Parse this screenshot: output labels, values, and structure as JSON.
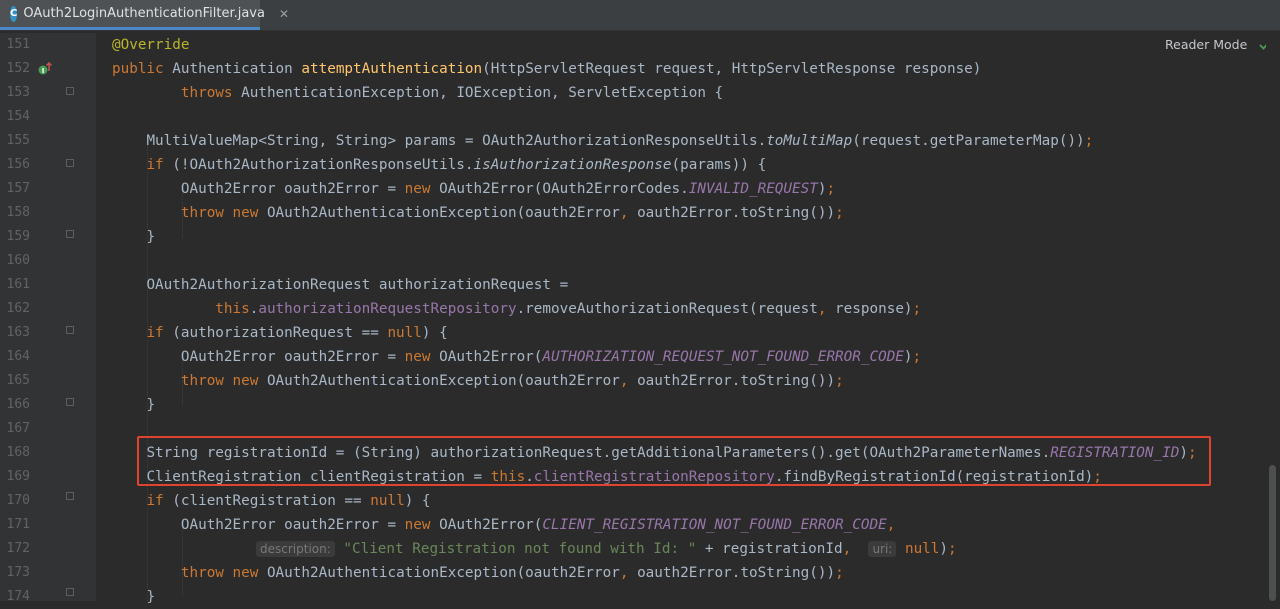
{
  "tab": {
    "title": "OAuth2LoginAuthenticationFilter.java",
    "icon_letter": "C",
    "close_label": "✕"
  },
  "toolbar": {
    "reader_mode": "Reader Mode"
  },
  "line_numbers": [
    "151",
    "152",
    "153",
    "154",
    "155",
    "156",
    "157",
    "158",
    "159",
    "160",
    "161",
    "162",
    "163",
    "164",
    "165",
    "166",
    "167",
    "168",
    "169",
    "170",
    "171",
    "172",
    "173",
    "174"
  ],
  "code": {
    "l151": {
      "ann": "@Override"
    },
    "l152": {
      "kw": "public",
      "t1": " Authentication ",
      "fn": "attemptAuthentication",
      "t2": "(HttpServletRequest request, HttpServletResponse response)"
    },
    "l153": {
      "kw": "throws",
      "t1": " AuthenticationException, IOException, ServletException {"
    },
    "l155": {
      "t1": "MultiValueMap<String, String> params = OAuth2AuthorizationResponseUtils.",
      "sm": "toMultiMap",
      "t2": "(request.getParameterMap())",
      "semi": ";"
    },
    "l156": {
      "kw": "if",
      "t1": " (!OAuth2AuthorizationResponseUtils.",
      "sm": "isAuthorizationResponse",
      "t2": "(params)) {"
    },
    "l157": {
      "t1": "OAuth2Error oauth2Error = ",
      "kw": "new",
      "t2": " OAuth2Error(OAuth2ErrorCodes.",
      "cst": "INVALID_REQUEST",
      "t3": ")",
      "semi": ";"
    },
    "l158": {
      "kw": "throw new",
      "t1": " OAuth2AuthenticationException(oauth2Error",
      "comma": ",",
      "t2": " oauth2Error.toString())",
      "semi": ";"
    },
    "l159": {
      "t1": "}"
    },
    "l161": {
      "t1": "OAuth2AuthorizationRequest authorizationRequest ="
    },
    "l162": {
      "kw": "this",
      "t1": ".",
      "fld": "authorizationRequestRepository",
      "t2": ".removeAuthorizationRequest(request",
      "comma": ",",
      "t3": " response)",
      "semi": ";"
    },
    "l163": {
      "kw": "if",
      "t1": " (authorizationRequest == ",
      "kw2": "null",
      "t2": ") {"
    },
    "l164": {
      "t1": "OAuth2Error oauth2Error = ",
      "kw": "new",
      "t2": " OAuth2Error(",
      "cst": "AUTHORIZATION_REQUEST_NOT_FOUND_ERROR_CODE",
      "t3": ")",
      "semi": ";"
    },
    "l165": {
      "kw": "throw new",
      "t1": " OAuth2AuthenticationException(oauth2Error",
      "comma": ",",
      "t2": " oauth2Error.toString())",
      "semi": ";"
    },
    "l166": {
      "t1": "}"
    },
    "l168": {
      "t1": "String registrationId = (String) authorizationRequest.getAdditionalParameters().get(OAuth2ParameterNames.",
      "cst": "REGISTRATION_ID",
      "t2": ")",
      "semi": ";"
    },
    "l169": {
      "t1": "ClientRegistration clientRegistration = ",
      "kw": "this",
      "t2": ".",
      "fld": "clientRegistrationRepository",
      "t3": ".findByRegistrationId(registrationId)",
      "semi": ";"
    },
    "l170": {
      "kw": "if",
      "t1": " (clientRegistration == ",
      "kw2": "null",
      "t2": ") {"
    },
    "l171": {
      "t1": "OAuth2Error oauth2Error = ",
      "kw": "new",
      "t2": " OAuth2Error(",
      "cst": "CLIENT_REGISTRATION_NOT_FOUND_ERROR_CODE",
      "comma": ","
    },
    "l172": {
      "hint1": "description:",
      "str": "\"Client Registration not found with Id: \"",
      "t1": " + registrationId",
      "comma": ",",
      "hint2": "uri:",
      "kw": "null",
      "t2": ")",
      "semi": ";"
    },
    "l173": {
      "kw": "throw new",
      "t1": " OAuth2AuthenticationException(oauth2Error",
      "comma": ",",
      "t2": " oauth2Error.toString())",
      "semi": ";"
    },
    "l174": {
      "t1": "}"
    }
  },
  "colors": {
    "keyword": "#cc7832",
    "method": "#ffc66d",
    "annotation": "#bbb529",
    "constant": "#9876aa",
    "string": "#6a8759",
    "highlight_box": "#e0432f"
  },
  "icons": {
    "file": "java-class-icon",
    "gutter": "implementation-marker-icon",
    "status": "checkmark-icon"
  }
}
